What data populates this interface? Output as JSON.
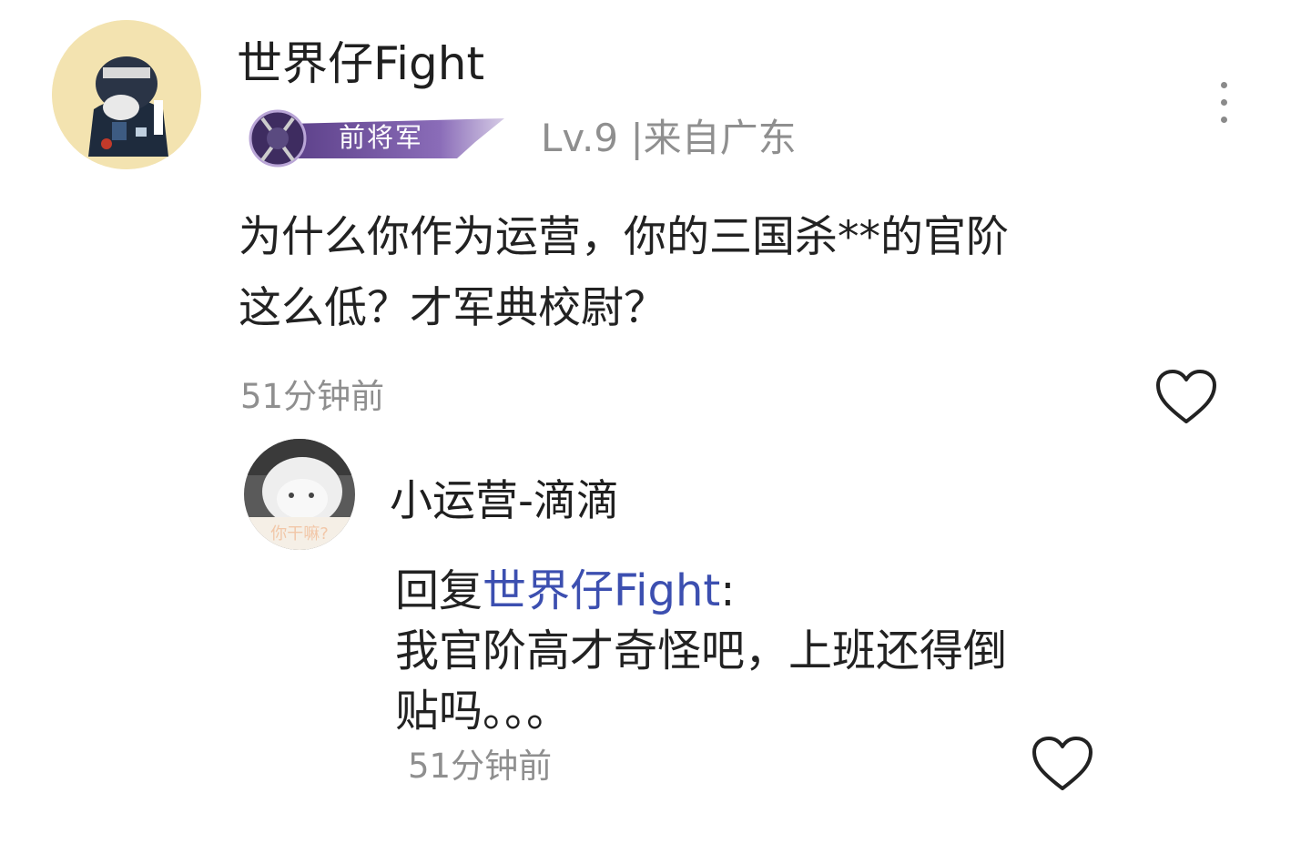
{
  "comment": {
    "username": "世界仔Fight",
    "rank_badge": "前将军",
    "level": "Lv.9",
    "location": "|来自广东",
    "text_line1": "为什么你作为运营，你的三国杀**的官阶",
    "text_line2": "这么低？才军典校尉？",
    "time": "51分钟前",
    "more_icon": "more-vertical-icon",
    "like_icon": "heart-outline-icon"
  },
  "reply": {
    "username": "小运营-滴滴",
    "avatar_caption": "你干嘛?",
    "prefix": "回复",
    "mention": "世界仔Fight",
    "colon": ":",
    "text_line1": "我官阶高才奇怪吧，上班还得倒",
    "text_line2": "贴吗。。。",
    "time": "51分钟前",
    "like_icon": "heart-outline-icon"
  },
  "colors": {
    "mention": "#3c4fb0",
    "meta": "#8f8f8f",
    "badge": "#5b3f88"
  }
}
